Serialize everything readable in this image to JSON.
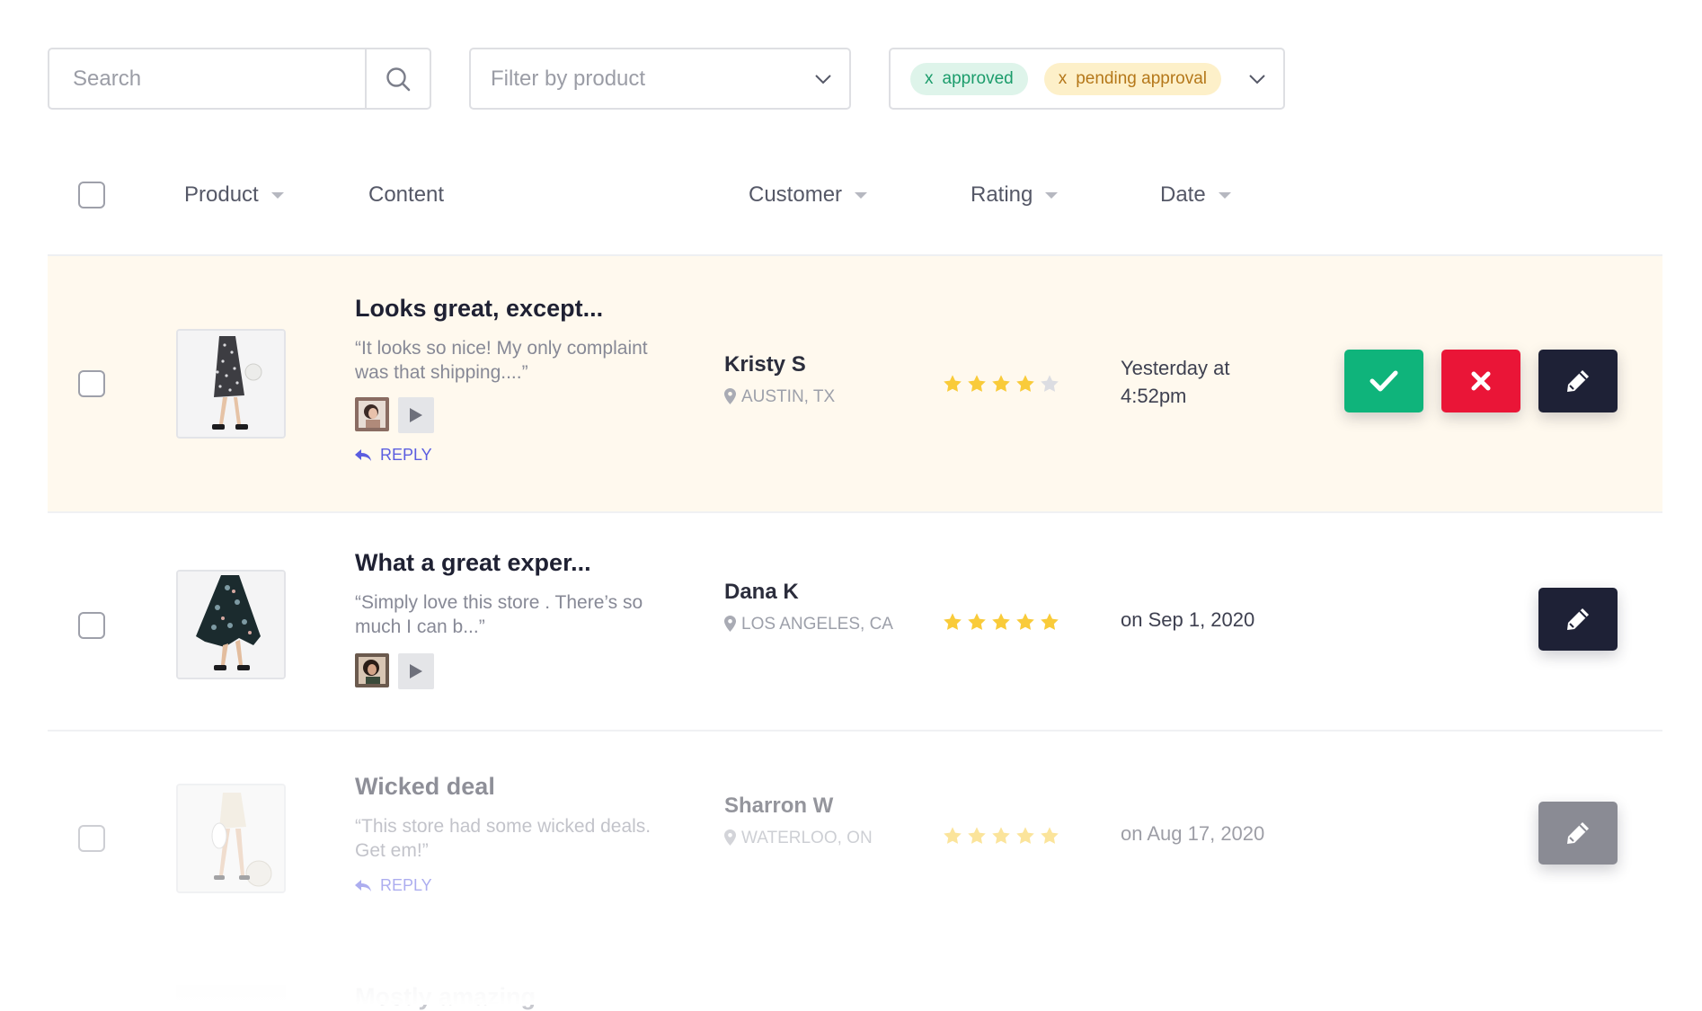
{
  "toolbar": {
    "search_placeholder": "Search",
    "search_value": "",
    "product_filter_placeholder": "Filter by product",
    "status_chips": [
      {
        "remove_glyph": "x",
        "label": "approved"
      },
      {
        "remove_glyph": "x",
        "label": "pending approval"
      }
    ]
  },
  "table": {
    "columns": {
      "product": "Product",
      "content": "Content",
      "customer": "Customer",
      "rating": "Rating",
      "date": "Date"
    },
    "rows": [
      {
        "title": "Looks great, except...",
        "quote": "“It looks so nice! My only complaint was that shipping....”",
        "has_media": true,
        "reply_label": "REPLY",
        "customer_name": "Kristy S",
        "location": "AUSTIN, TX",
        "rating": 4,
        "rating_max": 5,
        "date_line1": "Yesterday at",
        "date_line2": "4:52pm",
        "actions": [
          "approve",
          "reject",
          "edit"
        ]
      },
      {
        "title": "What a great exper...",
        "quote": "“Simply love this store . There’s so much I can b...”",
        "has_media": true,
        "customer_name": "Dana K",
        "location": "LOS ANGELES, CA",
        "rating": 5,
        "rating_max": 5,
        "date_line1": "on Sep 1, 2020",
        "actions": [
          "edit"
        ]
      },
      {
        "title": "Wicked deal",
        "quote": "“This store had some wicked deals. Get em!”",
        "reply_label": "REPLY",
        "customer_name": "Sharron W",
        "location": "WATERLOO, ON",
        "rating": 5,
        "rating_max": 5,
        "date_line1": "on Aug 17, 2020",
        "actions": [
          "edit"
        ]
      },
      {
        "title": "Mostly amazing"
      }
    ]
  },
  "icons": {
    "search": "search-icon",
    "dropdown": "chevron-down-icon",
    "location": "map-pin-icon",
    "star": "star-icon",
    "play": "play-icon",
    "reply": "reply-arrow-icon",
    "approve": "check-icon",
    "reject": "close-icon",
    "edit": "pencil-icon"
  },
  "colors": {
    "highlight_row": "#fff9ee",
    "approve": "#0fb47b",
    "reject": "#ea1537",
    "edit": "#1e2136",
    "star": "#f9cb3a",
    "star_empty": "#dcdde2",
    "reply_link": "#5b5de0",
    "chip_approved_bg": "#def4ea",
    "chip_approved_text": "#1b9c6b",
    "chip_pending_bg": "#fdf0c9",
    "chip_pending_text": "#b5781a"
  }
}
